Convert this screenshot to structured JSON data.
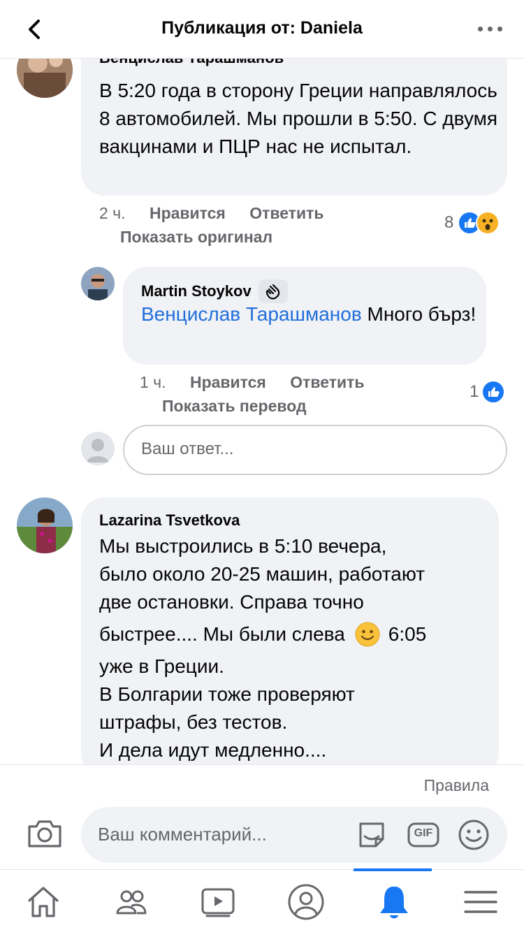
{
  "header": {
    "title": "Публикация от: Daniela",
    "icons": {
      "back": "chevron-left-icon",
      "more": "more-dots-icon"
    }
  },
  "comments": [
    {
      "author": "Венцислав Тарашманов",
      "text": "В 5:20 года в сторону Греции направлялось 8 автомобилей. Мы прошли в 5:50. С двумя вакцинами и ПЦР нас не испытал.",
      "time": "2 ч.",
      "like_label": "Нравится",
      "reply_label": "Ответить",
      "secondary_label": "Показать оригинал",
      "reaction_count": "8",
      "reactions": [
        "like",
        "wow"
      ]
    },
    {
      "author": "Martin Stoykov",
      "author_badge": "waving-hand-icon",
      "mention": "Венцислав Тарашманов",
      "text": " Много бърз!",
      "time": "1 ч.",
      "like_label": "Нравится",
      "reply_label": "Ответить",
      "secondary_label": "Показать перевод",
      "reaction_count": "1",
      "reactions": [
        "like"
      ]
    },
    {
      "author": "Lazarina Tsvetkova",
      "lines": [
        "Мы выстроились в 5:10 вечера,",
        "было около 20-25 машин, работают",
        "две остановки. Справа точно",
        "быстрее.... Мы были слева",
        "6:05",
        "уже в Греции.",
        "В Болгарии тоже проверяют",
        "штрафы, без тестов.",
        "И дела идут медленно...."
      ],
      "emoji": "slightly-smiling-face-icon"
    }
  ],
  "reply_input": {
    "placeholder": "Ваш ответ..."
  },
  "composer": {
    "rules_label": "Правила",
    "placeholder": "Ваш комментарий...",
    "gif_label": "GIF",
    "icons": [
      "camera-icon",
      "sticker-icon",
      "gif-icon",
      "emoji-icon"
    ]
  },
  "tabbar": {
    "tabs": [
      "home-icon",
      "friends-icon",
      "watch-icon",
      "profile-icon",
      "notifications-icon",
      "menu-icon"
    ],
    "active": "notifications-icon"
  },
  "colors": {
    "link": "#216fdb",
    "accent": "#1877f2",
    "bubble": "#f0f2f5",
    "muted": "#65676b"
  }
}
